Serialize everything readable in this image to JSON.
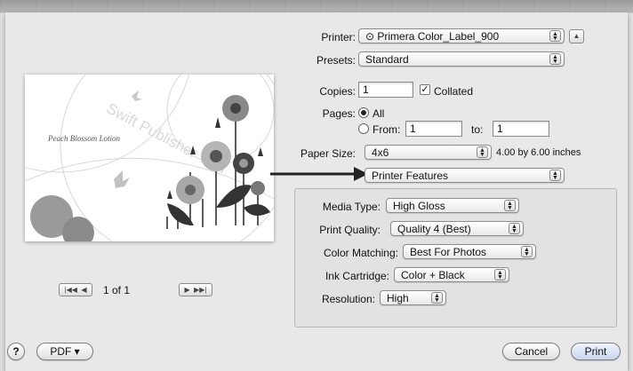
{
  "printer": {
    "label": "Printer:",
    "value": "Primera Color_Label_900"
  },
  "presets": {
    "label": "Presets:",
    "value": "Standard"
  },
  "copies": {
    "label": "Copies:",
    "value": "1",
    "collated_label": "Collated",
    "collated_checked": true
  },
  "pages": {
    "label": "Pages:",
    "all_label": "All",
    "from_label": "From:",
    "from_value": "1",
    "to_label": "to:",
    "to_value": "1",
    "selected": "All"
  },
  "paper_size": {
    "label": "Paper Size:",
    "value": "4x6",
    "dims": "4.00 by 6.00 inches"
  },
  "panel_select": {
    "value": "Printer Features"
  },
  "features": {
    "media_type": {
      "label": "Media Type:",
      "value": "High Gloss"
    },
    "print_quality": {
      "label": "Print Quality:",
      "value": "Quality 4 (Best)"
    },
    "color_matching": {
      "label": "Color Matching:",
      "value": "Best For Photos"
    },
    "ink_cartridge": {
      "label": "Ink Cartridge:",
      "value": "Color + Black"
    },
    "resolution": {
      "label": "Resolution:",
      "value": "High"
    }
  },
  "preview": {
    "label_text": "Peach Blossom Lotion",
    "watermark": "Swift Publisher Trial",
    "page_indicator": "1 of 1"
  },
  "footer": {
    "help": "?",
    "pdf": "PDF ▾",
    "cancel": "Cancel",
    "print": "Print"
  }
}
